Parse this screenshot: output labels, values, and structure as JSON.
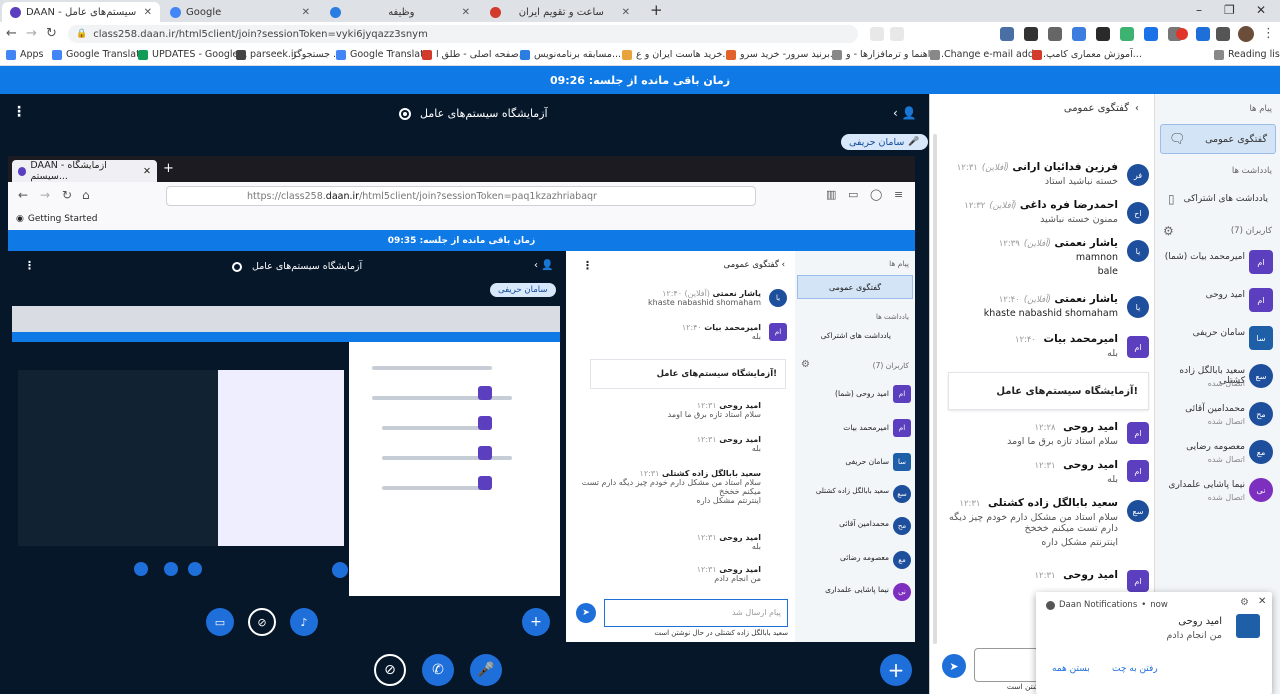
{
  "browser": {
    "tabs": [
      {
        "title": "DAAN - آزمایشگاه سیستم‌های عامل",
        "active": true,
        "color": "#5b3fbf"
      },
      {
        "title": "Google",
        "active": false,
        "color": "#4285f4"
      },
      {
        "title": "وظیفه",
        "active": false,
        "color": "#2a7de1"
      },
      {
        "title": "ساعت و تقویم ایران",
        "active": false,
        "color": "#d23a2b"
      }
    ],
    "new_tab": "+",
    "minimize": "–",
    "maximize": "❐",
    "close": "✕",
    "url": "class258.daan.ir/html5client/join?sessionToken=vyki6jyqazz3snym",
    "bookmarks": [
      "Apps",
      "Google Translate",
      "UPDATES - Google...",
      "parseek.ir",
      "جستجوگر ...",
      "Google Translate",
      "صفحه اصلی - طلق ا...",
      "مسابقه برنامه‌نویس...",
      "خرید هاست ایران و ع...",
      "برنید سرور- خرید سرو...",
      "راهنما و ترمافزارها - و...",
      "Change e-mail addr...",
      "آموزش معماری کامپ...",
      "Reading list"
    ]
  },
  "banner": {
    "text": "زمان باقی مانده از جلسه: 09:26"
  },
  "main": {
    "room_title": "آزمایشگاه سیستم‌های عامل",
    "presenter": "سامان حریفی",
    "shared": {
      "tab_title": "DAAN - آزمایشگاه سیستم...",
      "url_prefix": "https://class258.",
      "url_domain": "daan.ir",
      "url_suffix": "/html5client/join?sessionToken=paq1kzazhriabaqr",
      "bookmark": "Getting Started",
      "banner": "زمان باقی مانده از جلسه: 09:35",
      "room_title": "آزمایشگاه سیستم‌های عامل",
      "presenter": "سامان حریفی",
      "chat_header": "گفتگوی عمومی",
      "users_header": "پیام ها",
      "public_chat": "گفتگوی عمومی",
      "notes_header": "یادداشت ها",
      "shared_notes": "یادداشت های اشتراکی",
      "users_count": "کاربران (7)",
      "messages": [
        {
          "name": "یاشار نعمتی",
          "time": "۱۲:۴۰",
          "status": "(آفلاین)",
          "text": "khaste nabashid shomaham"
        },
        {
          "name": "امیرمحمد بیات",
          "time": "۱۲:۴۰",
          "text": "بله"
        },
        {
          "name": "امید روحی",
          "time": "۱۲:۳۱",
          "text": "سلام استاد تازه برق ما اومد"
        },
        {
          "name": "امید روحی",
          "time": "۱۲:۳۱",
          "text": "بله"
        },
        {
          "name": "سعید بابالگل زاده کشتلی",
          "time": "۱۲:۳۱",
          "text": "سلام استاد من مشکل دارم خودم چیز دیگه دارم تست میکنم خخخخ"
        },
        {
          "name": "",
          "time": "",
          "text": "اینترنتم مشکل داره"
        },
        {
          "name": "امید روحی",
          "time": "۱۲:۳۱",
          "text": "بله"
        },
        {
          "name": "امید روحی",
          "time": "۱۲:۳۱",
          "text": "من انجام دادم"
        }
      ],
      "sys_message": "آزمایشگاه سیستم‌های عامل!",
      "input_placeholder": "پیام ارسال شد",
      "typing": "سعید بابالگل زاده کشتلی در حال نوشتن است",
      "users": [
        {
          "name": "امید روحی (شما)",
          "sub": "",
          "initials": "ام"
        },
        {
          "name": "امیرمحمد بیات",
          "sub": "",
          "initials": "ام"
        },
        {
          "name": "سامان حریفی",
          "sub": "",
          "initials": "سا"
        },
        {
          "name": "سعید بابالگل زاده کشتلی",
          "sub": "",
          "initials": "سع"
        },
        {
          "name": "محمدامین آقائی",
          "sub": "",
          "initials": "مح"
        },
        {
          "name": "معصومه رضائی",
          "sub": "",
          "initials": "مع"
        },
        {
          "name": "نیما پاشایی علمداری",
          "sub": "",
          "initials": "نی"
        }
      ]
    }
  },
  "chat": {
    "header": "گفتگوی عمومی",
    "messages": [
      {
        "name": "فرزین فدائیان ارانی",
        "status": "(آفلاین)",
        "time": "۱۲:۳۱",
        "text": "خسته نباشید استاد",
        "initials": "فر",
        "color": "#1e4f9c"
      },
      {
        "name": "احمدرضا فره داغی",
        "status": "(آفلاین)",
        "time": "۱۲:۳۲",
        "text": "ممنون خسته نباشید",
        "initials": "اح",
        "color": "#1e4f9c"
      },
      {
        "name": "یاشار نعمتی",
        "status": "(آفلاین)",
        "time": "۱۲:۳۹",
        "text": "mamnon",
        "text2": "bale",
        "initials": "یا",
        "color": "#1e4f9c"
      },
      {
        "name": "یاشار نعمتی",
        "status": "(آفلاین)",
        "time": "۱۲:۴۰",
        "text": "khaste nabashid shomaham",
        "initials": "یا",
        "color": "#1e4f9c"
      },
      {
        "name": "امیرمحمد بیات",
        "status": "",
        "time": "۱۲:۴۰",
        "text": "بله",
        "initials": "ام",
        "color": "#5b3fbf"
      }
    ],
    "sys_message": "آزمایشگاه سیستم‌های عامل!",
    "messages2": [
      {
        "name": "امید روحی",
        "time": "۱۲:۲۸",
        "text": "سلام استاد تازه برق ما اومد",
        "initials": "ام",
        "color": "#5b3fbf"
      },
      {
        "name": "امید روحی",
        "time": "۱۲:۳۱",
        "text": "بله",
        "initials": "ام",
        "color": "#5b3fbf"
      },
      {
        "name": "سعید بابالگل زاده کشتلی",
        "time": "۱۲:۳۱",
        "text": "سلام استاد من مشکل دارم خودم چیز دیگه دارم تست میکنم خخخخ",
        "text2": "اینترنتم مشکل داره",
        "initials": "سع",
        "color": "#1e4f9c"
      },
      {
        "name": "امید روحی",
        "time": "۱۲:۳۱",
        "text": "",
        "initials": "ام",
        "color": "#5b3fbf"
      }
    ],
    "typing": "سعید بابالگل زاده کشتلی در حال نوشتن است"
  },
  "users_panel": {
    "messages_header": "پیام ها",
    "public_chat": "گفتگوی عمومی",
    "notes_header": "یادداشت ها",
    "shared_notes": "یادداشت های اشتراکی",
    "users_header": "کاربران (7)",
    "users": [
      {
        "name": "امیرمحمد بیات (شما)",
        "sub": "",
        "initials": "ام",
        "color": "#5b3fbf",
        "square": true
      },
      {
        "name": "امید روحی",
        "sub": "",
        "initials": "ام",
        "color": "#5b3fbf",
        "square": true
      },
      {
        "name": "سامان حریفی",
        "sub": "",
        "initials": "سا",
        "color": "#1f5fa8",
        "square": true
      },
      {
        "name": "سعید بابالگل زاده کشتلی",
        "sub": "اتصال شده",
        "initials": "سع",
        "color": "#1e4f9c",
        "square": false
      },
      {
        "name": "محمدامین آقائی",
        "sub": "اتصال شده",
        "initials": "مح",
        "color": "#1e4f9c",
        "square": false
      },
      {
        "name": "معصومه رضایی",
        "sub": "اتصال شده",
        "initials": "مع",
        "color": "#1e4f9c",
        "square": false
      },
      {
        "name": "نیما پاشایی علمداری",
        "sub": "اتصال شده",
        "initials": "نی",
        "color": "#7d2fbf",
        "square": false
      }
    ]
  },
  "notification": {
    "source": "Daan Notifications",
    "when": "now",
    "title": "امید روحی",
    "body": "من انجام دادم",
    "btn_close": "بستن همه",
    "btn_goto": "رفتن به چت"
  }
}
